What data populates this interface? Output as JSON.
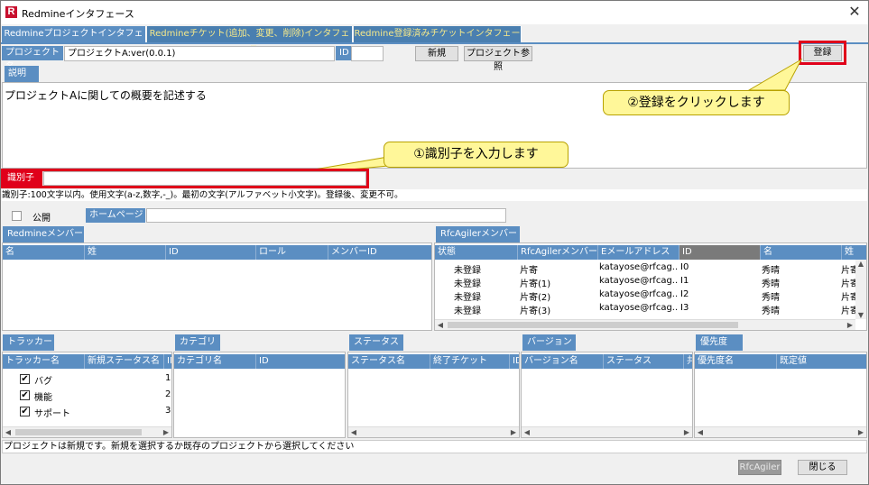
{
  "window": {
    "title": "Redmineインタフェース",
    "app_icon": "R"
  },
  "tabs": [
    {
      "label": "Redmineプロジェクトインタフェース"
    },
    {
      "label": "Redmineチケット(追加、変更、削除)インタフェース"
    },
    {
      "label": "Redmine登録済みチケットインタフェース"
    }
  ],
  "project": {
    "name_label": "プロジェクト名",
    "name_value": "プロジェクトA:ver(0.0.1)",
    "id_label": "ID",
    "new_button": "新規",
    "browse_button": "プロジェクト参照",
    "register_button": "登録"
  },
  "description": {
    "label": "説明",
    "text": "プロジェクトAに関しての概要を記述する"
  },
  "identifier": {
    "label": "識別子",
    "value": "",
    "hint": "識別子:100文字以内。使用文字(a-z,数字,-_)。最初の文字(アルファベット小文字)。登録後、変更不可。"
  },
  "callouts": {
    "step1": "①識別子を入力します",
    "step2": "②登録をクリックします"
  },
  "public": {
    "label": "公開",
    "checked": false
  },
  "homepage": {
    "label": "ホームページ",
    "value": ""
  },
  "redmine_members": {
    "tab": "Redmineメンバー",
    "columns": [
      "名",
      "姓",
      "ID",
      "ロール",
      "メンバーID"
    ]
  },
  "rfc_members": {
    "tab": "RfcAgilerメンバー",
    "columns": [
      "状態",
      "RfcAgilerメンバー名",
      "Eメールアドレス",
      "ID",
      "名",
      "姓"
    ],
    "rows": [
      [
        "未登録",
        "片寄",
        "katayose@rfcag...",
        "I0",
        "秀晴",
        "片寄"
      ],
      [
        "未登録",
        "片寄(1)",
        "katayose@rfcag...",
        "I1",
        "秀晴",
        "片寄"
      ],
      [
        "未登録",
        "片寄(2)",
        "katayose@rfcag...",
        "I2",
        "秀晴",
        "片寄"
      ],
      [
        "未登録",
        "片寄(3)",
        "katayose@rfcag...",
        "I3",
        "秀晴",
        "片寄"
      ]
    ]
  },
  "tracker": {
    "tab": "トラッカー",
    "columns": [
      "トラッカー名",
      "新規ステータス名",
      "ID"
    ],
    "rows": [
      {
        "name": "バグ",
        "id": "1",
        "checked": true
      },
      {
        "name": "機能",
        "id": "2",
        "checked": true
      },
      {
        "name": "サポート",
        "id": "3",
        "checked": true
      }
    ]
  },
  "category": {
    "tab": "カテゴリ",
    "columns": [
      "カテゴリ名",
      "ID"
    ]
  },
  "status": {
    "tab": "ステータス",
    "columns": [
      "ステータス名",
      "終了チケット",
      "ID"
    ]
  },
  "version": {
    "tab": "バージョン",
    "columns": [
      "バージョン名",
      "ステータス",
      "共"
    ]
  },
  "priority": {
    "tab": "優先度",
    "columns": [
      "優先度名",
      "既定値"
    ]
  },
  "status_bar": "プロジェクトは新規です。新規を選択するか既存のプロジェクトから選択してください",
  "footer": {
    "rfc_button": "RfcAgiler",
    "close_button": "閉じる"
  },
  "colors": {
    "accent": "#5b8ec2",
    "highlight": "#e0001a",
    "callout": "#fff799"
  }
}
